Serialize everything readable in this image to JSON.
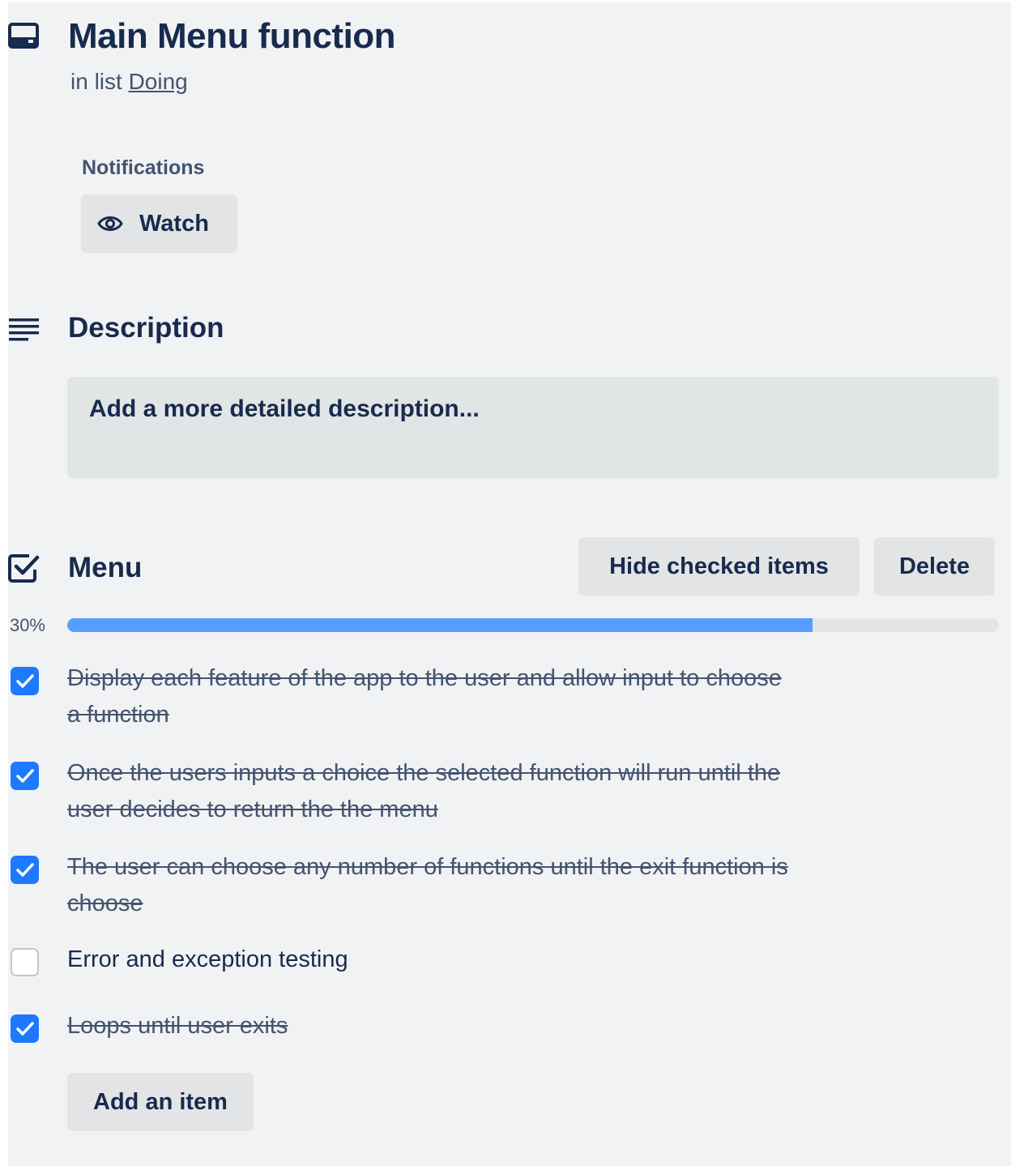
{
  "card": {
    "title": "Main Menu function",
    "in_list_prefix": "in list",
    "list_name": "Doing"
  },
  "notifications": {
    "label": "Notifications",
    "watch_label": "Watch"
  },
  "description": {
    "title": "Description",
    "placeholder": "Add a more detailed description..."
  },
  "checklist": {
    "title": "Menu",
    "hide_checked_label": "Hide checked items",
    "delete_label": "Delete",
    "progress_text": "30%",
    "progress": 0.8,
    "items": [
      {
        "text": "Display each feature of the app to the user and allow input to choose a function",
        "checked": true
      },
      {
        "text": "Once the users inputs a choice the selected function will run until the user decides to return the the menu",
        "checked": true
      },
      {
        "text": "The user can choose any number of functions until the exit function is choose",
        "checked": true
      },
      {
        "text": "Error and exception testing",
        "checked": false
      },
      {
        "text": "Loops until user exits",
        "checked": true
      }
    ],
    "add_item_label": "Add an item"
  },
  "colors": {
    "accent": "#1d7afc",
    "progress": "#579dff",
    "text": "#172b4d",
    "panel": "#f1f2f4"
  },
  "icons": [
    "card-icon",
    "eye-icon",
    "description-icon",
    "checklist-icon",
    "checkmark-icon"
  ]
}
